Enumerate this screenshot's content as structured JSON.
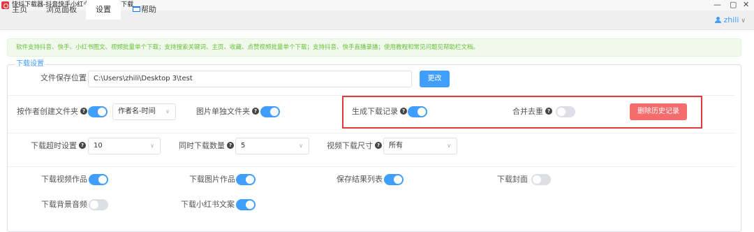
{
  "window": {
    "title": "快抖下载器-抖音快手小红书去水印批量下载",
    "minimize": "—",
    "maximize": "▢",
    "close": "✕"
  },
  "tabs": [
    {
      "label": "主页"
    },
    {
      "label": "浏览面板"
    },
    {
      "label": "设置",
      "active": true
    },
    {
      "label": "帮助"
    }
  ],
  "user": {
    "name": "zhili",
    "caret": "∨"
  },
  "notice": "软件支持抖音、快手、小红书图文、视频批量单个下载；支持搜索关键词、主页、收藏、点赞视频批量单个下载；支持抖音、快手直播录播；使用教程和常见问题见帮助栏文档。",
  "section_title": "下载设置",
  "save_path": {
    "label": "文件保存位置",
    "value": "C:\\Users\\zhili\\Desktop 3\\test",
    "button": "更改"
  },
  "row2": {
    "author_folder": {
      "label": "按作者创建文件夹",
      "on": true
    },
    "folder_name_select": {
      "value": "作者名-时间"
    },
    "image_folder": {
      "label": "图片单独文件夹",
      "on": true
    },
    "gen_record": {
      "label": "生成下载记录",
      "on": true
    },
    "dedupe": {
      "label": "合并去重",
      "on": false
    },
    "delete_history": "删除历史记录"
  },
  "row3": {
    "timeout": {
      "label": "下载超时设置",
      "value": "10"
    },
    "concurrent": {
      "label": "同时下载数量",
      "value": "5"
    },
    "video_size": {
      "label": "视频下载尺寸",
      "value": "所有"
    }
  },
  "row4": {
    "video_works": {
      "label": "下载视频作品",
      "on": true
    },
    "image_works": {
      "label": "下载图片作品",
      "on": true
    },
    "save_list": {
      "label": "保存结果列表",
      "on": true
    },
    "cover": {
      "label": "下载封面",
      "on": false
    }
  },
  "row5": {
    "bg_audio": {
      "label": "下载背景音频",
      "on": false
    },
    "xhs_text": {
      "label": "下载小红书文案",
      "on": true
    }
  },
  "help_glyph": "?",
  "select_caret": "∨",
  "colors": {
    "accent": "#409eff",
    "danger": "#f56c6c",
    "notice_bg": "#f0f9eb",
    "notice_text": "#67c23a",
    "highlight": "#e03a3a"
  }
}
